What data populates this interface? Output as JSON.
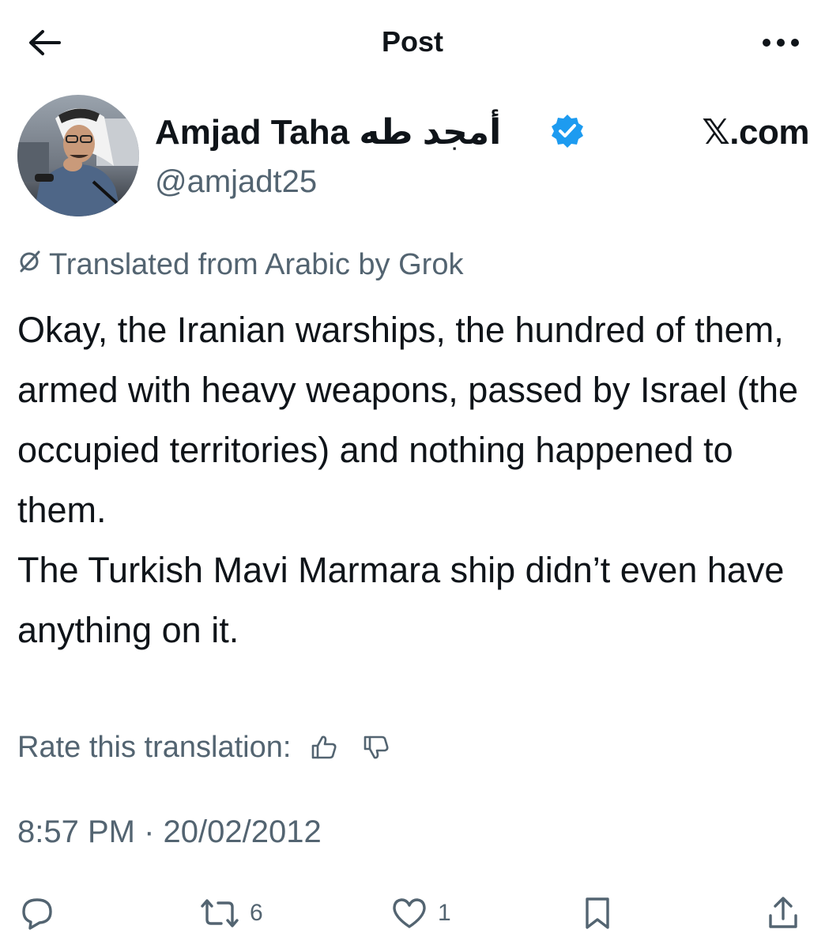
{
  "header": {
    "title": "Post",
    "back_icon": "arrow-left-icon",
    "more_icon": "more-horizontal-icon"
  },
  "author": {
    "display_name": "Amjad Taha أمجد طه",
    "handle": "@amjadt25",
    "verified": true,
    "badge_color": "#1d9bf0",
    "site_label": "𝕏.com"
  },
  "translation_notice": {
    "icon": "translate-icon",
    "text": "Translated from Arabic by Grok"
  },
  "post": {
    "paragraphs": [
      "Okay, the Iranian warships, the hundred of them, armed with heavy weapons, passed by Israel (the occupied territories) and nothing happened to them.",
      "The Turkish Mavi Marmara ship didn’t even have anything on it."
    ]
  },
  "rate": {
    "label": "Rate this translation:",
    "up_icon": "thumbs-up-icon",
    "down_icon": "thumbs-down-icon"
  },
  "timestamp": "8:57 PM · 20/02/2012",
  "actions": {
    "reply_icon": "reply-icon",
    "repost_icon": "repost-icon",
    "repost_count": "6",
    "like_icon": "heart-icon",
    "like_count": "1",
    "bookmark_icon": "bookmark-icon",
    "share_icon": "share-icon"
  },
  "colors": {
    "text_primary": "#0f1419",
    "text_secondary": "#536471",
    "accent": "#1d9bf0"
  }
}
